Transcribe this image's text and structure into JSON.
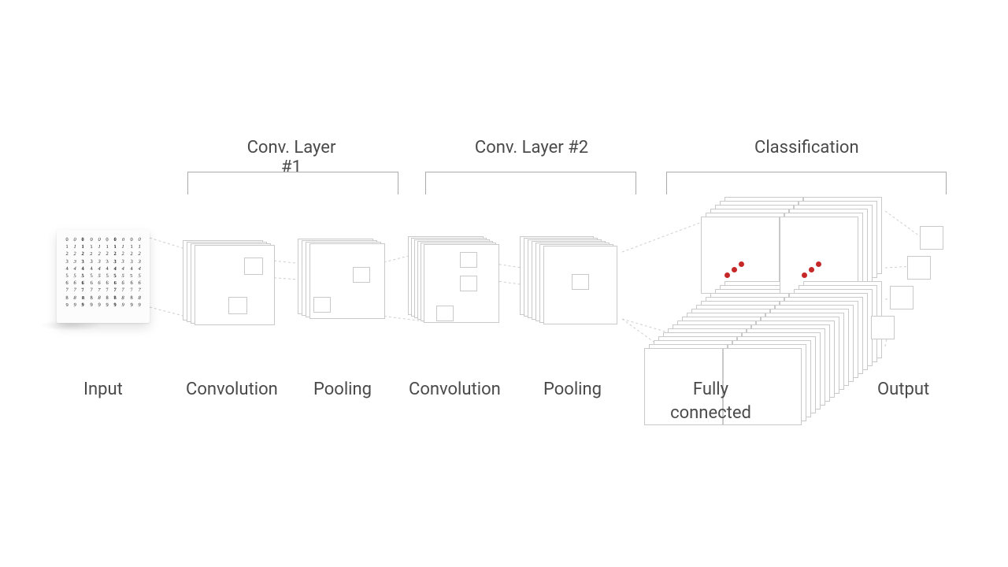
{
  "headers": {
    "conv1": "Conv. Layer #1",
    "conv2": "Conv. Layer #2",
    "classification": "Classification"
  },
  "stages": {
    "input": "Input",
    "convolution1": "Convolution",
    "pooling1": "Pooling",
    "convolution2": "Convolution",
    "pooling2": "Pooling",
    "fully_connected": "Fully\nconnected",
    "output": "Output"
  },
  "diagram": {
    "description": "CNN architecture schematic: input image of handwritten digits feeds into two convolution+pooling blocks, then fully-connected classification layers producing an output vector.",
    "input": {
      "rows": 10,
      "cols": 10,
      "digit_variants": "0-9 handwritten samples"
    },
    "blocks": [
      {
        "name": "Conv. Layer #1",
        "ops": [
          "Convolution",
          "Pooling"
        ]
      },
      {
        "name": "Conv. Layer #2",
        "ops": [
          "Convolution",
          "Pooling"
        ]
      },
      {
        "name": "Classification",
        "ops": [
          "Fully connected",
          "Output"
        ]
      }
    ],
    "stack_depth": 6,
    "fc_groups": 2,
    "output_nodes": 4,
    "accent_dots": 3
  },
  "colors": {
    "stroke": "#c9c9c9",
    "text": "#4a4a4a",
    "accent": "#c62828"
  }
}
